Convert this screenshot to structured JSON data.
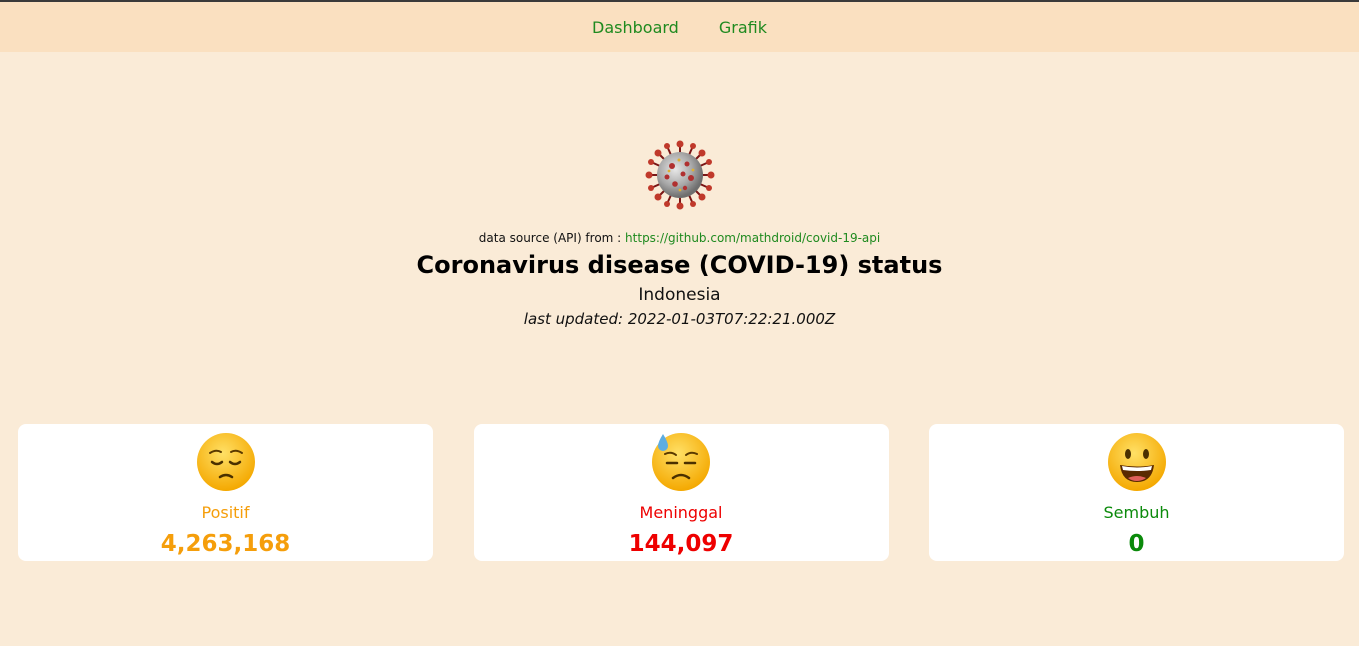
{
  "nav": {
    "items": [
      {
        "label": "Dashboard"
      },
      {
        "label": "Grafik"
      }
    ]
  },
  "hero": {
    "icon": "coronavirus-icon",
    "source_prefix": "data source (API) from :",
    "source_link": "https://github.com/mathdroid/covid-19-api",
    "title": "Coronavirus disease (COVID-19) status",
    "country": "Indonesia",
    "last_updated": "last updated: 2022-01-03T07:22:21.000Z"
  },
  "cards": [
    {
      "icon": "pensive-face-icon",
      "label": "Positif",
      "value": "4,263,168",
      "color": "#f59e0b"
    },
    {
      "icon": "downcast-face-with-sweat-icon",
      "label": "Meninggal",
      "value": "144,097",
      "color": "#ee0000"
    },
    {
      "icon": "grinning-face-icon",
      "label": "Sembuh",
      "value": "0",
      "color": "#0b8a0b"
    }
  ],
  "colors": {
    "background": "#faebd7",
    "navbar": "#fae0c0",
    "link": "#1f8a1f"
  }
}
